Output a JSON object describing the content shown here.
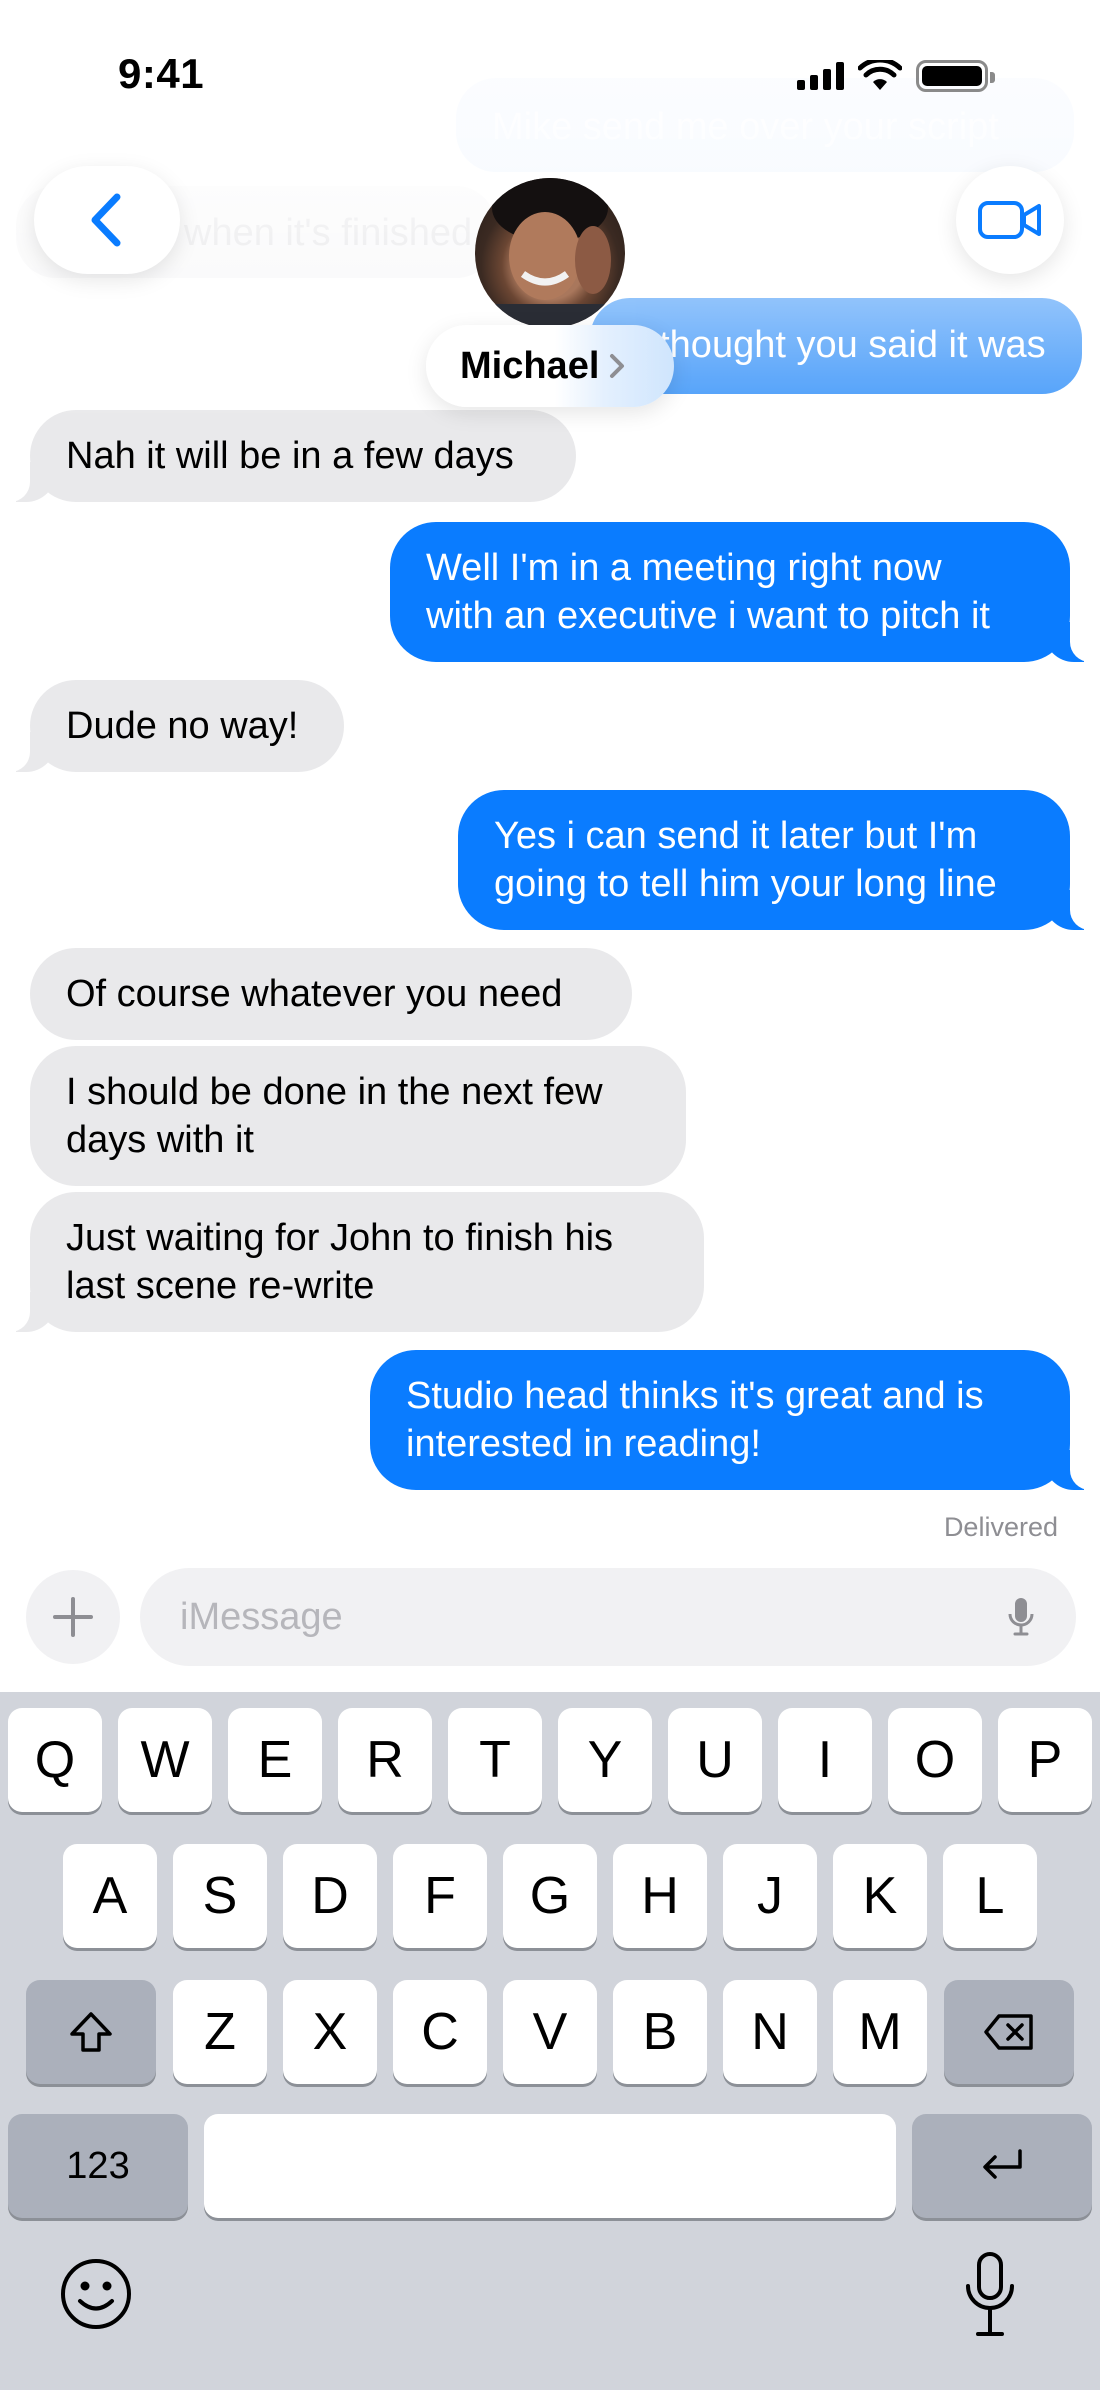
{
  "status_bar": {
    "time": "9:41"
  },
  "header": {
    "contact_name": "Michael",
    "back_icon": "chevron-left-icon",
    "video_icon": "video-camera-icon"
  },
  "faded_messages": [
    {
      "direction": "outgoing",
      "text": "Mike send me over your script"
    },
    {
      "direction": "incoming",
      "text": "when it's finished"
    },
    {
      "direction": "outgoing",
      "text": "I thought you said it was"
    }
  ],
  "messages": [
    {
      "direction": "incoming",
      "text": "Nah it will be in a few days"
    },
    {
      "direction": "outgoing",
      "lines": [
        "Well I'm in a meeting right now",
        "with an executive i want to pitch it"
      ]
    },
    {
      "direction": "incoming",
      "text": "Dude no way!"
    },
    {
      "direction": "outgoing",
      "lines": [
        "Yes i can send it later but I'm",
        "going to tell him your long line"
      ]
    },
    {
      "direction": "incoming",
      "text": "Of course whatever you need"
    },
    {
      "direction": "incoming",
      "lines": [
        "I should be done in the next few",
        "days with it"
      ]
    },
    {
      "direction": "incoming",
      "lines": [
        "Just waiting for John to finish his",
        "last scene re-write"
      ]
    },
    {
      "direction": "outgoing",
      "lines": [
        "Studio head thinks it's great and is",
        "interested in reading!"
      ]
    }
  ],
  "delivery_status": "Delivered",
  "composer": {
    "placeholder": "iMessage",
    "plus_icon": "plus-icon",
    "mic_icon": "microphone-icon"
  },
  "keyboard": {
    "row1": [
      "Q",
      "W",
      "E",
      "R",
      "T",
      "Y",
      "U",
      "I",
      "O",
      "P"
    ],
    "row2": [
      "A",
      "S",
      "D",
      "F",
      "G",
      "H",
      "J",
      "K",
      "L"
    ],
    "row3": [
      "Z",
      "X",
      "C",
      "V",
      "B",
      "N",
      "M"
    ],
    "numbers_key": "123",
    "shift_icon": "shift-icon",
    "delete_icon": "backspace-icon",
    "return_icon": "return-icon",
    "emoji_icon": "emoji-icon",
    "dictation_icon": "microphone-icon"
  },
  "colors": {
    "outgoing_bubble": "#0a7cff",
    "incoming_bubble": "#e9e9eb",
    "accent": "#0a7cff",
    "keyboard_bg": "#d1d4db"
  }
}
